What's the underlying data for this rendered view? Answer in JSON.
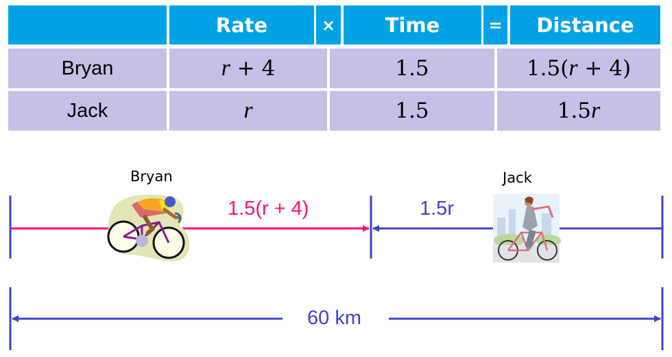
{
  "table": {
    "headers": {
      "blank": "",
      "rate": "Rate",
      "times_symbol": "×",
      "time": "Time",
      "equals_symbol": "=",
      "distance": "Distance"
    },
    "rows": [
      {
        "name": "Bryan",
        "rate": "r + 4",
        "time": "1.5",
        "distance": "1.5(r + 4)"
      },
      {
        "name": "Jack",
        "rate": "r",
        "time": "1.5",
        "distance": "1.5r"
      }
    ]
  },
  "diagram": {
    "bryan_label": "Bryan",
    "jack_label": "Jack",
    "bryan_distance_label": "1.5(r + 4)",
    "jack_distance_label": "1.5r",
    "total_distance_label": "60 km",
    "colors": {
      "header_bg": "#00a2e6",
      "row_bg": "#c7bfe5",
      "bryan_line": "#ff0f7b",
      "jack_line": "#4040cc"
    }
  }
}
